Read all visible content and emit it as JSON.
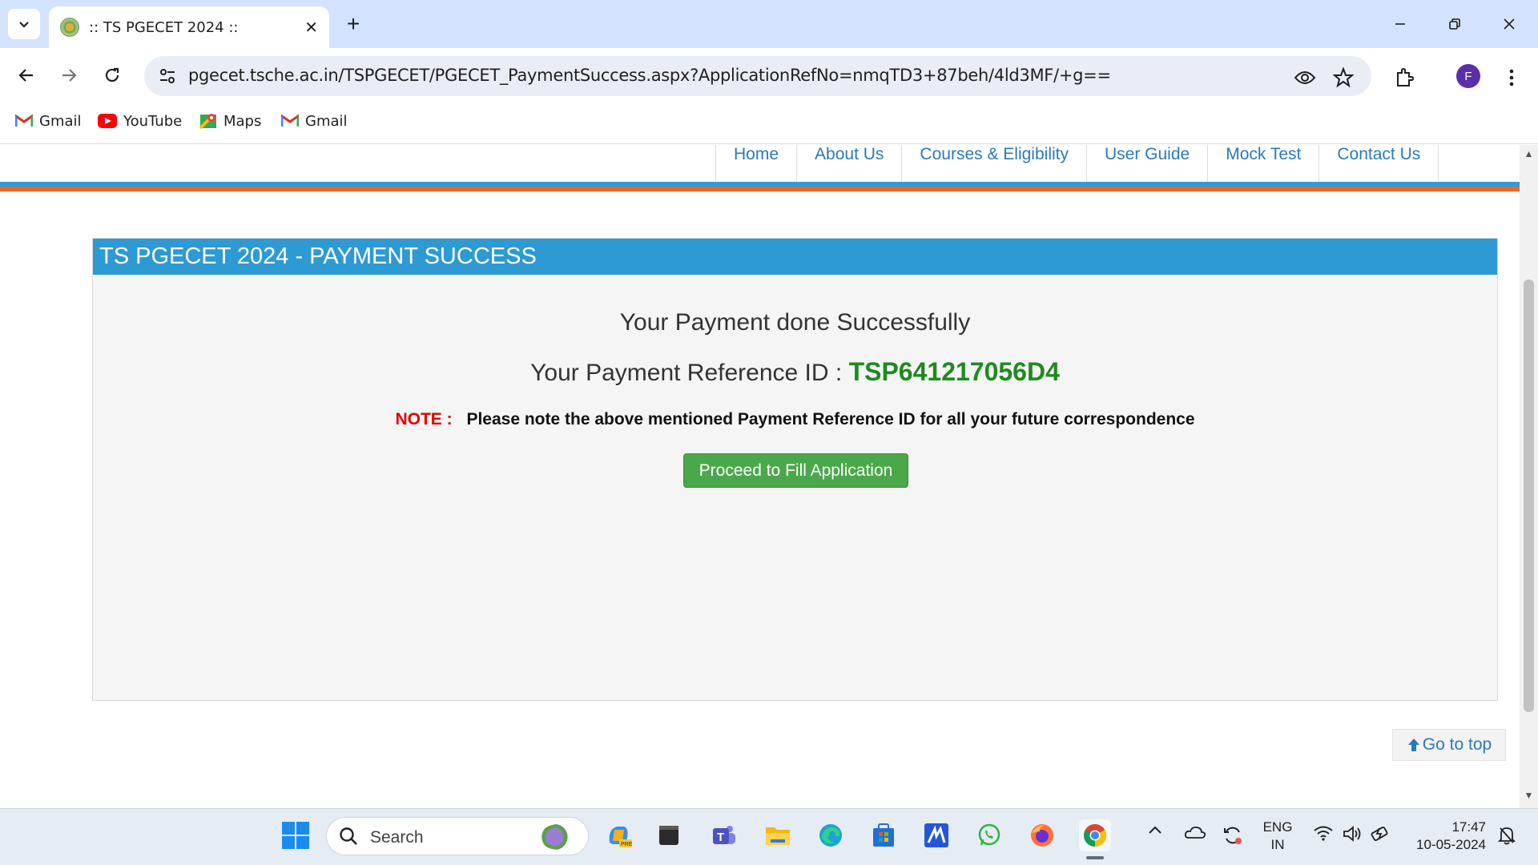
{
  "browser": {
    "tab_title": ":: TS PGECET 2024 ::",
    "tab_close": "✕",
    "new_tab": "+",
    "url": "pgecet.tsche.ac.in/TSPGECET/PGECET_PaymentSuccess.aspx?ApplicationRefNo=nmqTD3+87beh/4ld3MF/+g==",
    "profile_initial": "F",
    "bookmarks": [
      {
        "label": "Gmail",
        "icon": "gmail-icon"
      },
      {
        "label": "YouTube",
        "icon": "youtube-icon"
      },
      {
        "label": "Maps",
        "icon": "maps-icon"
      },
      {
        "label": "Gmail",
        "icon": "gmail-icon"
      }
    ]
  },
  "site": {
    "nav": [
      "Home",
      "About Us",
      "Courses & Eligibility",
      "User Guide",
      "Mock Test",
      "Contact Us"
    ],
    "panel_title": "TS PGECET 2024 - PAYMENT SUCCESS",
    "success_message": "Your Payment done Successfully",
    "reference_label": "Your Payment Reference ID : ",
    "reference_id": "TSP641217056D4",
    "note_label": "NOTE :",
    "note_text": "Please note the above mentioned Payment Reference ID for all your future correspondence",
    "proceed_button": "Proceed to Fill Application",
    "go_to_top": "Go to top"
  },
  "taskbar": {
    "search_label": "Search",
    "language_line1": "ENG",
    "language_line2": "IN",
    "time": "17:47",
    "date": "10-05-2024"
  },
  "colors": {
    "panel_header": "#2d9ad3",
    "reference_id": "#1e8a1e",
    "note_label": "#e00000",
    "proceed_button": "#4aa84a",
    "nav_link": "#2a7ab8",
    "band_blue": "#2d9cdb",
    "band_orange": "#f26722"
  }
}
